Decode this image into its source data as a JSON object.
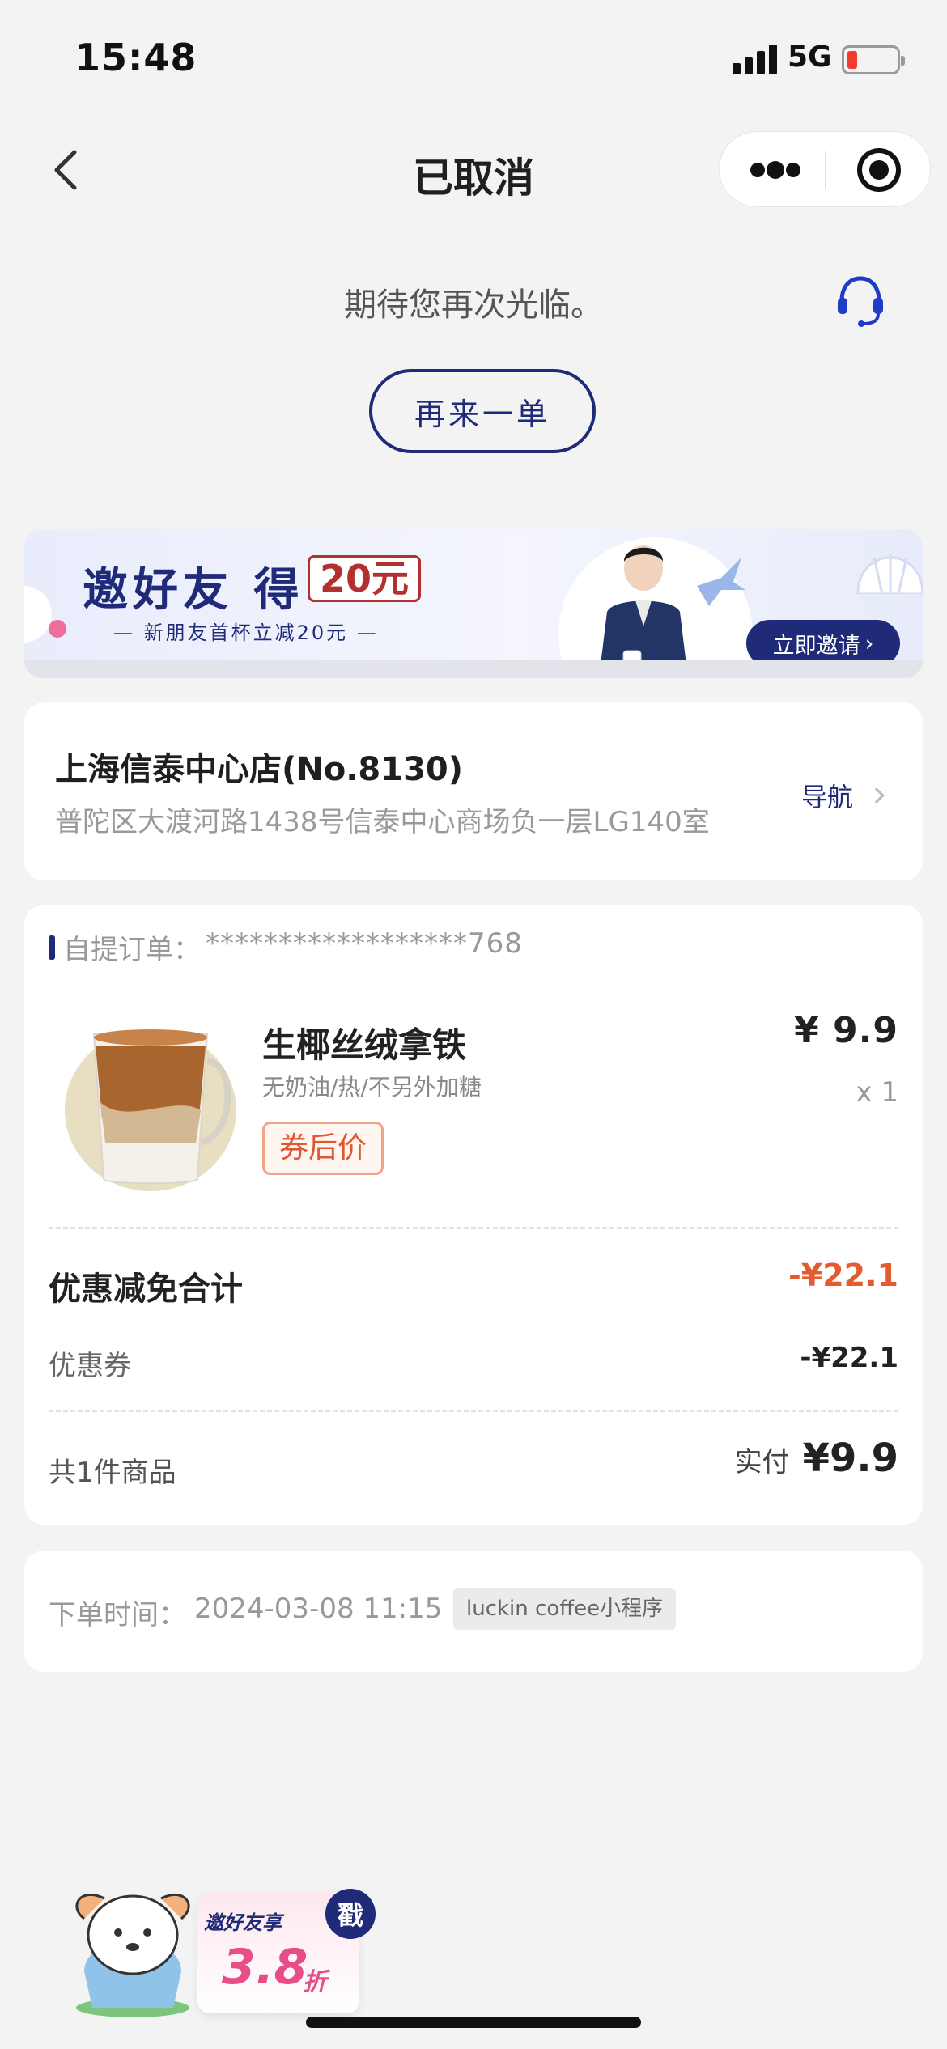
{
  "status_bar": {
    "time": "15:48",
    "network": "5G"
  },
  "nav": {
    "title": "已取消"
  },
  "hero": {
    "message": "期待您再次光临。",
    "reorder_label": "再来一单"
  },
  "banner": {
    "title": "邀好友 得",
    "amount": "20元",
    "subtitle": "— 新朋友首杯立减20元 —",
    "invite_label": "立即邀请"
  },
  "store": {
    "name": "上海信泰中心店(No.8130)",
    "address": "普陀区大渡河路1438号信泰中心商场负一层LG140室",
    "nav_label": "导航"
  },
  "order": {
    "type_label": "自提订单：",
    "number": "******************768",
    "item": {
      "name": "生椰丝绒拿铁",
      "spec": "无奶油/热/不另外加糖",
      "tag": "券后价",
      "price": "¥ 9.9",
      "quantity": "x 1"
    },
    "discount_label": "优惠减免合计",
    "discount_total": "-¥22.1",
    "coupon_label": "优惠券",
    "coupon_value": "-¥22.1",
    "count_label": "共1件商品",
    "paid_label": "实付",
    "paid_value": "¥9.9"
  },
  "meta": {
    "time_label": "下单时间：",
    "time_value": "2024-03-08 11:15",
    "channel": "luckin coffee小程序"
  },
  "promo": {
    "title": "邀好友享",
    "discount": "3.8",
    "unit": "折",
    "stamp": "戳"
  },
  "colors": {
    "brand": "#1f2a78",
    "accent": "#e45b2f",
    "background": "#f3f3f4"
  }
}
